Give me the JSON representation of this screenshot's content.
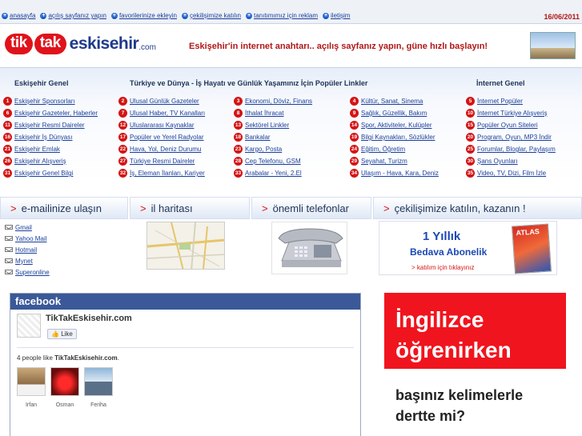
{
  "topnav": {
    "items": [
      "anasayfa",
      "açılış sayfanız yapın",
      "favorilerinize ekleyin",
      "çekilişimize katılın",
      "tanıtımımız için reklam",
      "iletişim"
    ],
    "date": "16/06/2011"
  },
  "header": {
    "logo_tik": "tik",
    "logo_tak": "tak",
    "logo_city": "eskisehir",
    "logo_com": ".com",
    "slogan_bold": "Eskişehir'in internet anahtarı..",
    "slogan_rest": " açılış sayfanız yapın, güne hızlı başlayın!"
  },
  "links": {
    "col1_title": "Eskişehir Genel",
    "col_mid_title": "Türkiye ve Dünya - İş Hayatı ve Günlük Yaşamınız İçin Popüler Linkler",
    "col5_title": "İnternet Genel",
    "col1": [
      {
        "n": "1",
        "t": "Eskişehir Sponsorları"
      },
      {
        "n": "6",
        "t": "Eskişehir Gazeteler, Haberler"
      },
      {
        "n": "11",
        "t": "Eskişehir Resmi Daireler"
      },
      {
        "n": "16",
        "t": "Eskişehir İş Dünyası"
      },
      {
        "n": "21",
        "t": "Eskişehir Emlak"
      },
      {
        "n": "26",
        "t": "Eskişehir Alışveriş"
      },
      {
        "n": "31",
        "t": "Eskişehir Genel Bilgi"
      }
    ],
    "col2": [
      {
        "n": "2",
        "t": "Ulusal Günlük Gazeteler"
      },
      {
        "n": "7",
        "t": "Ulusal Haber, TV Kanalları"
      },
      {
        "n": "12",
        "t": "Uluslararası Kaynaklar"
      },
      {
        "n": "17",
        "t": "Popüler ve Yerel Radyolar"
      },
      {
        "n": "22",
        "t": "Hava, Yol, Deniz Durumu"
      },
      {
        "n": "27",
        "t": "Türkiye Resmi Daireler"
      },
      {
        "n": "32",
        "t": "İş, Eleman İlanları, Kariyer"
      }
    ],
    "col3": [
      {
        "n": "3",
        "t": "Ekonomi, Döviz, Finans"
      },
      {
        "n": "8",
        "t": "İthalat İhracat"
      },
      {
        "n": "13",
        "t": "Sektörel Linkler"
      },
      {
        "n": "18",
        "t": "Bankalar"
      },
      {
        "n": "23",
        "t": "Kargo, Posta"
      },
      {
        "n": "28",
        "t": "Cep Telefonu, GSM"
      },
      {
        "n": "33",
        "t": "Arabalar - Yeni, 2.El"
      }
    ],
    "col4": [
      {
        "n": "4",
        "t": "Kültür, Sanat, Sinema"
      },
      {
        "n": "9",
        "t": "Sağlık, Güzellik, Bakım"
      },
      {
        "n": "14",
        "t": "Spor, Aktiviteler, Kulüpler"
      },
      {
        "n": "19",
        "t": "Bilgi Kaynakları, Sözlükler"
      },
      {
        "n": "24",
        "t": "Eğitim, Öğretim"
      },
      {
        "n": "29",
        "t": "Seyahat, Turizm"
      },
      {
        "n": "34",
        "t": "Ulaşım - Hava, Kara, Deniz"
      }
    ],
    "col5": [
      {
        "n": "5",
        "t": "İnternet Popüler"
      },
      {
        "n": "10",
        "t": "İnternet Türkiye Alışveriş"
      },
      {
        "n": "15",
        "t": "Popüler Oyun Siteleri"
      },
      {
        "n": "20",
        "t": "Program, Oyun, MP3 İndir"
      },
      {
        "n": "25",
        "t": "Forumlar, Bloglar, Paylaşım"
      },
      {
        "n": "30",
        "t": "Şans Oyunları"
      },
      {
        "n": "35",
        "t": "Video, TV, Dizi, Film İzle"
      }
    ]
  },
  "strip": {
    "email": "e-mailinize ulaşın",
    "map": "il haritası",
    "phones": "önemli telefonlar",
    "raffle": "çekilişimize katılın, kazanın !",
    "arrow": ">"
  },
  "mail_links": [
    "Gmail",
    "Yahoo Mail",
    "Hotmail",
    "Mynet",
    "Superonline"
  ],
  "promo": {
    "year": "1 Yıllık",
    "free": "Bedava Abonelik",
    "cta": "> katılım için tıklayınız",
    "mag": "ATLAS"
  },
  "facebook": {
    "brand": "facebook",
    "page_name": "TikTakEskisehir.com",
    "like": "Like",
    "count_prefix": "4 people like ",
    "count_name": "TikTakEskisehir.com",
    "count_suffix": ".",
    "friends": [
      "Irfan",
      "Osman",
      "Feriha"
    ]
  },
  "ad": {
    "line1": "İngilizce",
    "line2": "öğrenirken",
    "line3": "başınız kelimelerle",
    "line4": "dertte mi?"
  }
}
